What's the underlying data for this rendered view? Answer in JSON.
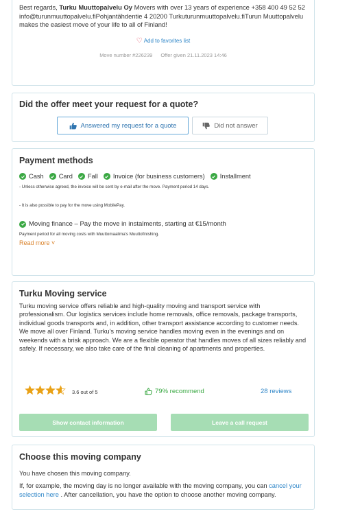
{
  "offer": {
    "text_before_bold": "Best regards, ",
    "company_bold": "Turku Muuttopalvelu Oy",
    "text_after_bold": " Movers with over 13 years of experience +358 400 49 52 52",
    "line_contact": "info@turunmuuttopalvelu.fiPohjantähdentie 4 20200 Turkuturunmuuttopalvelu.fiTurun Muuttopalvelu makes the easiest move of your life to all of Finland!",
    "favorite_label": "Add to favorites list",
    "move_number": "Move number #226239",
    "offer_given": "Offer given 21.11.2023 14:46"
  },
  "quote": {
    "title": "Did the offer meet your request for a quote?",
    "yes_label": "Answered my request for a quote",
    "no_label": "Did not answer"
  },
  "payment": {
    "title": "Payment methods",
    "methods": [
      "Cash",
      "Card",
      "Fall",
      "Invoice (for business customers)",
      "Installment"
    ],
    "note1": "- Unless otherwise agreed, the invoice will be sent by e-mail after the move. Payment period 14 days.",
    "note2": "- It is also possible to pay for the move using MobilePay.",
    "finance_label": "Moving finance – Pay the move in instalments, starting at €15/month",
    "finance_note": "Payment period for all moving costs with Muuttomaailma's Muuttofinishing.",
    "read_more": "Read more"
  },
  "service": {
    "title": "Turku Moving service",
    "description": "Turku moving service offers reliable and high-quality moving and transport service with professionalism. Our logistics services include home removals, office removals, package transports, individual goods transports and, in addition, other transport assistance according to customer needs. We move all over Finland. Turku's moving service handles moving even in the evenings and on weekends with a brisk approach. We are a flexible operator that handles moves of all sizes reliably and safely. If necessary, we also take care of the final cleaning of apartments and properties.",
    "rating": 3.6,
    "rating_text": "3.6 out of 5",
    "recommend_text": "79% recommend",
    "reviews_text": "28 reviews",
    "contact_button": "Show contact information",
    "call_button": "Leave a call request"
  },
  "choose": {
    "title": "Choose this moving company",
    "line1": "You have chosen this moving company.",
    "line2_before": "If, for example, the moving day is no longer available with the moving company, you can ",
    "line2_link": "cancel your selection here",
    "line2_after": " . After cancellation, you have the option to choose another moving company."
  },
  "colors": {
    "accent_blue": "#2f86c8",
    "accent_green": "#3aa843",
    "star_gold": "#e9a116",
    "button_green": "#a6ddb4"
  }
}
